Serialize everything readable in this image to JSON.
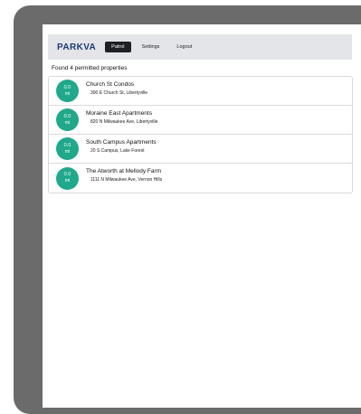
{
  "navbar": {
    "brand": "PARKVA",
    "items": [
      {
        "label": "Patrol",
        "active": true
      },
      {
        "label": "Settings",
        "active": false
      },
      {
        "label": "Logout",
        "active": false
      }
    ]
  },
  "results": {
    "summary": "Found 4 permitted properties",
    "properties": [
      {
        "distance": "0.0",
        "unit": "mi",
        "name": "Church St Condos",
        "address": "300 E Church St, Libertyville"
      },
      {
        "distance": "0.0",
        "unit": "mi",
        "name": "Moraine East Apartments",
        "address": "820 N Milwaukee Ave, Libertyville"
      },
      {
        "distance": "0.0",
        "unit": "mi",
        "name": "South Campus Apartments",
        "address": "20 S Campus, Lake Forest"
      },
      {
        "distance": "0.0",
        "unit": "mi",
        "name": "The Atworth at Mellody Farm",
        "address": "1111 N Milwaukee Ave, Vernon Hills"
      }
    ]
  },
  "colors": {
    "badge": "#1fa98a",
    "brand": "#1f3b73",
    "navbar_bg": "#e4e5e9",
    "active_tab": "#1d1f24"
  }
}
